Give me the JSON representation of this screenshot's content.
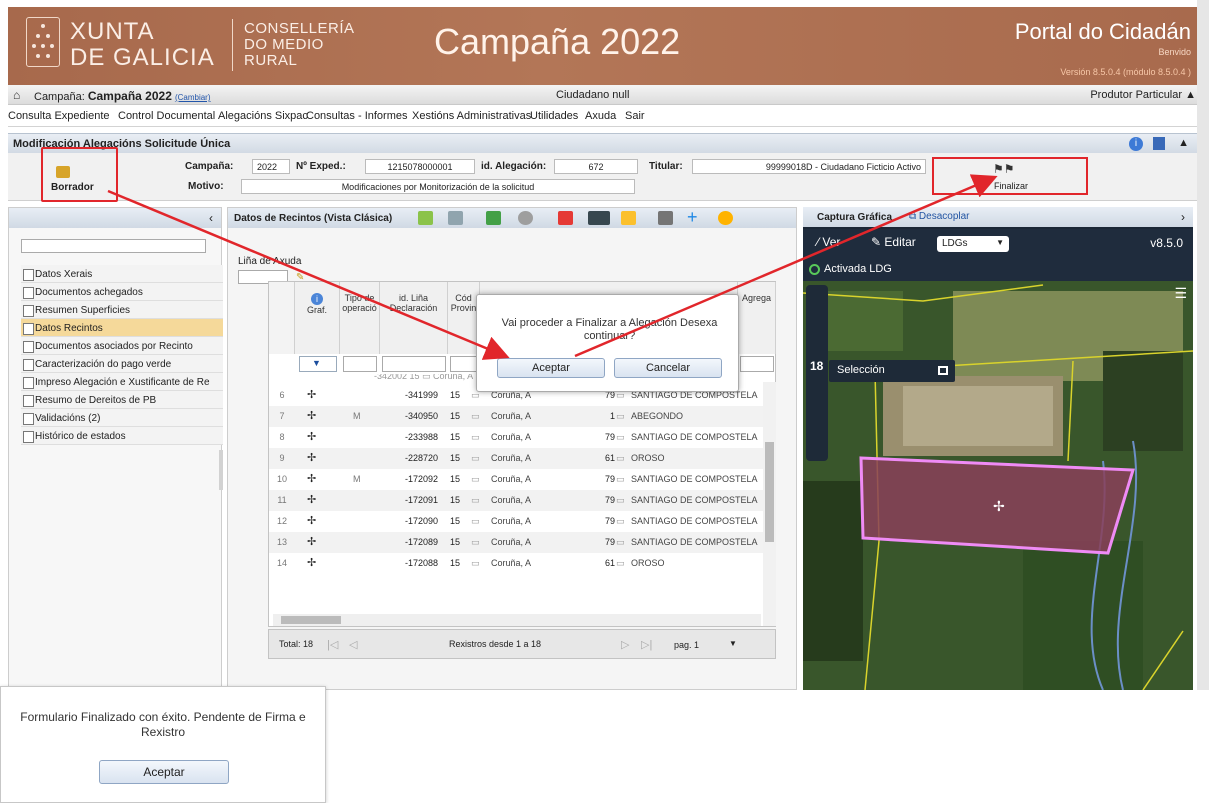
{
  "header": {
    "xunta_line1": "XUNTA",
    "xunta_line2": "DE GALICIA",
    "conselleria_line1": "CONSELLERÍA",
    "conselleria_line2": "DO MEDIO",
    "conselleria_line3": "RURAL",
    "title": "Campaña 2022",
    "portal": "Portal do Cidadán",
    "welcome": "Benvido",
    "version": "Versión 8.5.0.4 (módulo 8.5.0.4 )"
  },
  "campaign_bar": {
    "label": "Campaña:",
    "value": "Campaña 2022",
    "change": "(Cambiar)",
    "citizen": "Ciudadano null",
    "profile": "Produtor Particular"
  },
  "menu": [
    "Consulta Expediente",
    "Control Documental",
    "Alegacións Sixpac",
    "Consultas - Informes",
    "Xestións Administrativas",
    "Utilidades",
    "Axuda",
    "Sair"
  ],
  "form": {
    "title": "Modificación Alegacións Solicitude Única",
    "status": "Borrador",
    "campaign_label": "Campaña:",
    "campaign": "2022",
    "exped_label": "Nº Exped.:",
    "exped": "1215078000001",
    "alegacion_label": "id. Alegación:",
    "alegacion": "672",
    "titular_label": "Titular:",
    "titular": "99999018D - Ciudadano Ficticio Activo",
    "motivo_label": "Motivo:",
    "motivo": "Modificaciones por Monitorización de la solicitud",
    "finalize": "Finalizar"
  },
  "left_nav": [
    "Datos Xerais",
    "Documentos achegados",
    "Resumen Superficies",
    "Datos Recintos",
    "Documentos asociados por Recinto",
    "Caracterización do pago verde",
    "Impreso Alegación e Xustificante de Re",
    "Resumo de Dereitos de PB",
    "Validacións (2)",
    "Histórico de estados"
  ],
  "center": {
    "title": "Datos de Recintos (Vista Clásica)",
    "help_line": "Liña de Axuda",
    "columns": [
      "Graf.",
      "Tipo de operació",
      "id. Liña Declaración",
      "Cód Provin",
      "Agrega"
    ],
    "rows": [
      {
        "n": "6",
        "op": "",
        "id": "-341999",
        "prov": "15",
        "name": "Coruña, A",
        "code": "79",
        "mun": "SANTIAGO DE COMPOSTELA"
      },
      {
        "n": "7",
        "op": "M",
        "id": "-340950",
        "prov": "15",
        "name": "Coruña, A",
        "code": "1",
        "mun": "ABEGONDO"
      },
      {
        "n": "8",
        "op": "",
        "id": "-233988",
        "prov": "15",
        "name": "Coruña, A",
        "code": "79",
        "mun": "SANTIAGO DE COMPOSTELA"
      },
      {
        "n": "9",
        "op": "",
        "id": "-228720",
        "prov": "15",
        "name": "Coruña, A",
        "code": "61",
        "mun": "OROSO"
      },
      {
        "n": "10",
        "op": "M",
        "id": "-172092",
        "prov": "15",
        "name": "Coruña, A",
        "code": "79",
        "mun": "SANTIAGO DE COMPOSTELA"
      },
      {
        "n": "11",
        "op": "",
        "id": "-172091",
        "prov": "15",
        "name": "Coruña, A",
        "code": "79",
        "mun": "SANTIAGO DE COMPOSTELA"
      },
      {
        "n": "12",
        "op": "",
        "id": "-172090",
        "prov": "15",
        "name": "Coruña, A",
        "code": "79",
        "mun": "SANTIAGO DE COMPOSTELA"
      },
      {
        "n": "13",
        "op": "",
        "id": "-172089",
        "prov": "15",
        "name": "Coruña, A",
        "code": "79",
        "mun": "SANTIAGO DE COMPOSTELA"
      },
      {
        "n": "14",
        "op": "",
        "id": "-172088",
        "prov": "15",
        "name": "Coruña, A",
        "code": "61",
        "mun": "OROSO"
      }
    ],
    "total": "Total: 18",
    "records": "Rexistros desde 1 a 18",
    "page": "pag. 1"
  },
  "right": {
    "title": "Captura Gráfica",
    "undock": "Desacoplar",
    "view": "Ver",
    "edit": "Editar",
    "layer": "LDGs",
    "version": "v8.5.0",
    "ldg_status": "Activada LDG",
    "selection": "Selección",
    "zoom": "18"
  },
  "modal": {
    "message": "Vai proceder a Finalizar a Alegación Desexa continuar?",
    "accept": "Aceptar",
    "cancel": "Cancelar"
  },
  "final_dialog": {
    "message": "Formulario Finalizado con éxito. Pendente de Firma e Rexistro",
    "accept": "Aceptar"
  },
  "colors": {
    "header": "#a86a4d",
    "selected_nav": "#f5d99a",
    "annotation": "#e1262b"
  }
}
